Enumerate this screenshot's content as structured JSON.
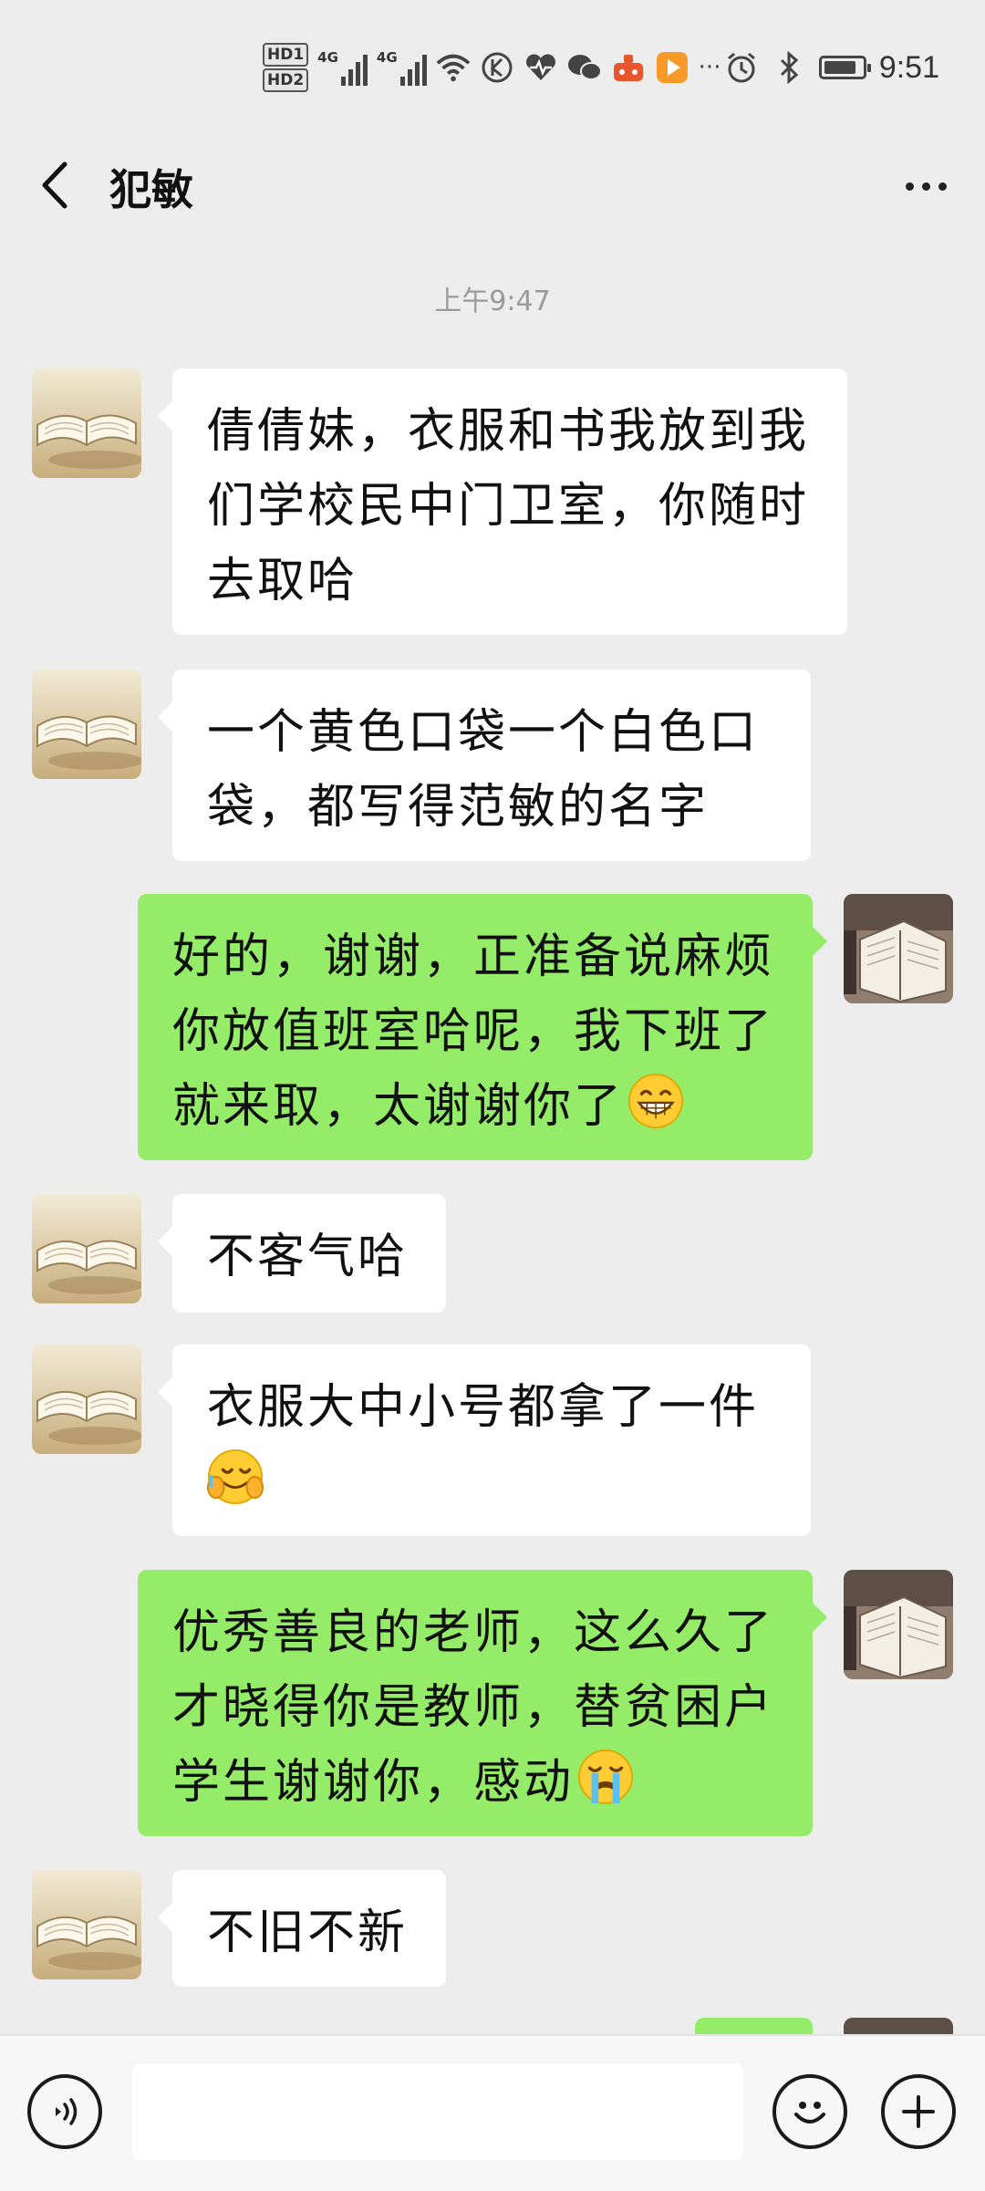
{
  "status_bar": {
    "hd1": "HD1",
    "hd2": "HD2",
    "net1": "4G",
    "net2": "4G",
    "more_glyph": "···",
    "time": "9:51",
    "battery_level": 0.85
  },
  "header": {
    "back_icon": "chevron-left-icon",
    "title": "犯敏",
    "more_icon": "more-dots-icon"
  },
  "timestamp": "上午9:47",
  "messages": [
    {
      "side": "in",
      "text": "倩倩妹，衣服和书我放到我们学校民中门卫室，你随时去取哈"
    },
    {
      "side": "in",
      "text": "一个黄色口袋一个白色口袋，都写得范敏的名字"
    },
    {
      "side": "out",
      "text": "好的，谢谢，正准备说麻烦你放值班室哈呢，我下班了就来取，太谢谢你了",
      "emoji": "grinning-face"
    },
    {
      "side": "in",
      "text": "不客气哈"
    },
    {
      "side": "in",
      "text": "衣服大中小号都拿了一件",
      "emoji": "face-palm-laughing"
    },
    {
      "side": "out",
      "text": "优秀善良的老师，这么久了才晓得你是教师，替贫困户学生谢谢你，感动",
      "emoji": "crying-face"
    },
    {
      "side": "in",
      "text": "不旧不新"
    }
  ],
  "bottom_bar": {
    "voice_icon": "voice-icon",
    "input_value": "",
    "emoji_icon": "smiley-icon",
    "plus_icon": "plus-icon"
  },
  "colors": {
    "background": "#ededed",
    "outgoing_bubble": "#95ec69",
    "incoming_bubble": "#ffffff"
  }
}
